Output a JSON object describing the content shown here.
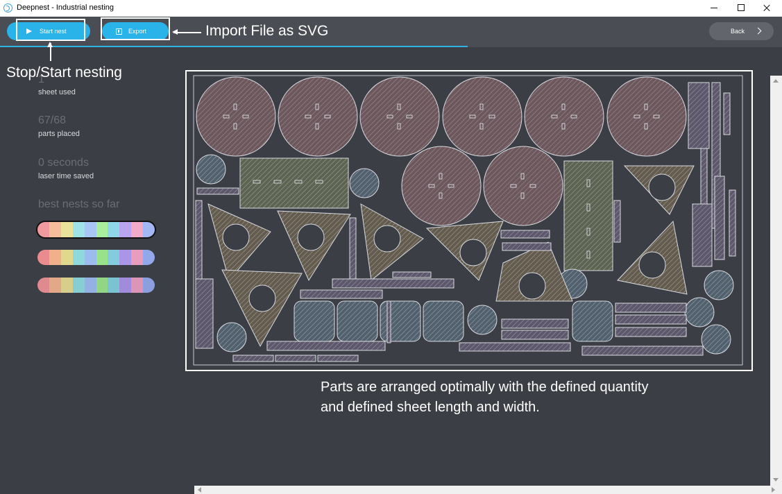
{
  "window": {
    "title": "Deepnest - Industrial nesting",
    "icon": "deepnest-logo-icon"
  },
  "toolbar": {
    "start_label": "Start nest",
    "export_label": "Export",
    "back_label": "Back",
    "accent_color": "#2ab3e8"
  },
  "annotations": {
    "import": "Import File as SVG",
    "stop_start": "Stop/Start nesting",
    "description": "Parts are arranged optimally with the defined quantity and defined sheet length and width."
  },
  "stats": {
    "sheets_value": "1",
    "sheets_label": "sheet used",
    "parts_value": "67/68",
    "parts_label": "parts placed",
    "time_value": "0 seconds",
    "time_label": "laser time saved",
    "nests_title": "best nests so far"
  },
  "nests": [
    {
      "selected": true,
      "colors": [
        "#f09aa0",
        "#f6bd9a",
        "#e9e29a",
        "#9fe3e6",
        "#a8c6f4",
        "#a9ee9c",
        "#8fd7e8",
        "#b9a4ef",
        "#f2aac9",
        "#a2b7f3"
      ]
    },
    {
      "selected": false,
      "colors": [
        "#ea8c8f",
        "#f0b08a",
        "#e1d88f",
        "#8fd9dc",
        "#9bbcec",
        "#98e28b",
        "#83cbdd",
        "#aa95e6",
        "#e89cbe",
        "#93a8ea"
      ]
    },
    {
      "selected": false,
      "colors": [
        "#de8a8e",
        "#e3a887",
        "#d6ce8a",
        "#86ced2",
        "#93b2e2",
        "#91d585",
        "#7bc2d3",
        "#a18cdb",
        "#dc95b6",
        "#8b9fdf"
      ]
    }
  ]
}
